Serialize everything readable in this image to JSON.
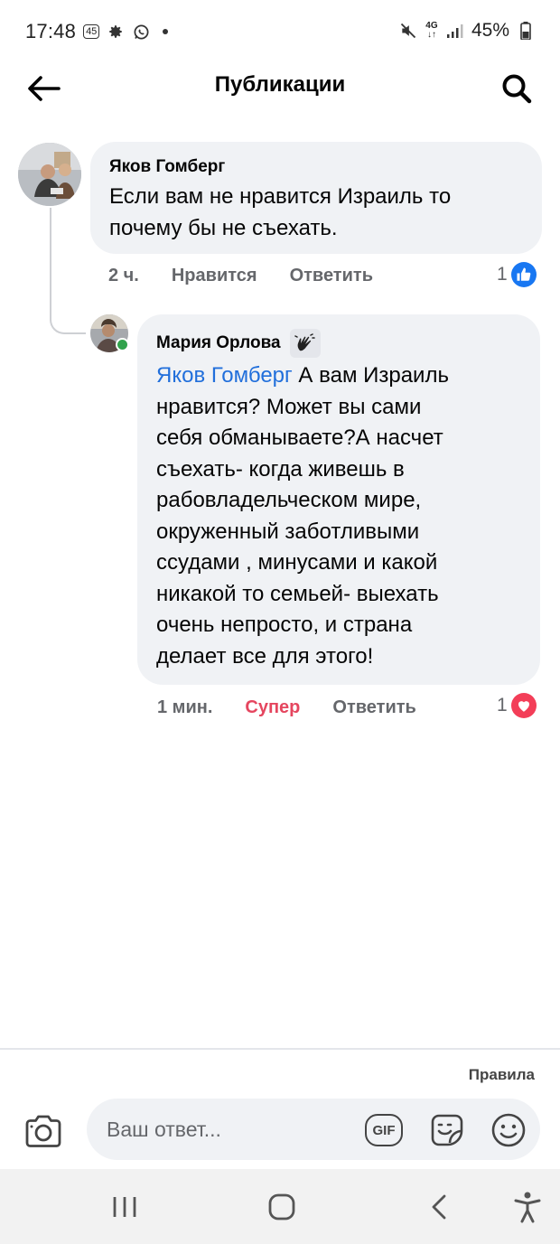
{
  "status_bar": {
    "time": "17:48",
    "notif_badge": "45",
    "network": "4G",
    "battery": "45%"
  },
  "header": {
    "title": "Публикации",
    "back_icon": "arrow-left-icon",
    "search_icon": "search-icon"
  },
  "comments": [
    {
      "author": "Яков Гомберг",
      "text": "Если вам не нравится Израиль то почему бы не съехать.",
      "text_lines": [
        "Если вам не нравится Израиль то",
        "почему бы не съехать."
      ],
      "time": "2 ч.",
      "like_label": "Нравится",
      "reply_label": "Ответить",
      "reaction_count": "1",
      "reaction": "like"
    },
    {
      "author": "Мария Орлова",
      "badge_icon": "waving-hands-icon",
      "mention": "Яков Гомберг",
      "text": "А вам Израиль нравится? Может вы сами себя обманываете?А насчет съехать- когда живешь в рабовладельческом мире, окруженный заботливыми ссудами , минусами  и какой никакой то семьей- выехать очень непросто, и страна делает все для этого!",
      "text_lines": [
        " А вам Израиль",
        "нравится? Может вы сами",
        "себя обманываете?А насчет",
        "съехать- когда живешь в",
        "рабовладельческом мире,",
        "окруженный заботливыми",
        "ссудами , минусами  и какой",
        "никакой то семьей- выехать",
        "очень непросто, и страна",
        "делает все для этого!"
      ],
      "time": "1 мин.",
      "like_label": "Супер",
      "reply_label": "Ответить",
      "reaction_count": "1",
      "reaction": "love",
      "online": true
    }
  ],
  "composer": {
    "rules_label": "Правила",
    "placeholder": "Ваш ответ...",
    "gif_label": "GIF"
  },
  "colors": {
    "like_blue": "#1877f2",
    "love_red": "#f33e58",
    "super_label": "#e5465f",
    "mention_blue": "#216fdb",
    "bubble_bg": "#f0f2f5",
    "online_green": "#31a24c"
  }
}
